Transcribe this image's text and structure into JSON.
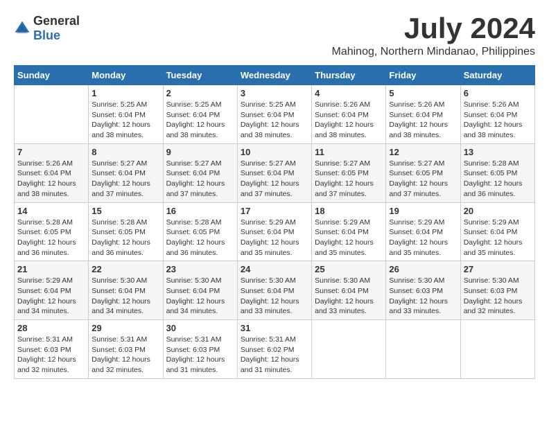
{
  "header": {
    "logo_general": "General",
    "logo_blue": "Blue",
    "month_title": "July 2024",
    "location": "Mahinog, Northern Mindanao, Philippines"
  },
  "calendar": {
    "days_of_week": [
      "Sunday",
      "Monday",
      "Tuesday",
      "Wednesday",
      "Thursday",
      "Friday",
      "Saturday"
    ],
    "weeks": [
      [
        {
          "day": "",
          "info": ""
        },
        {
          "day": "1",
          "info": "Sunrise: 5:25 AM\nSunset: 6:04 PM\nDaylight: 12 hours\nand 38 minutes."
        },
        {
          "day": "2",
          "info": "Sunrise: 5:25 AM\nSunset: 6:04 PM\nDaylight: 12 hours\nand 38 minutes."
        },
        {
          "day": "3",
          "info": "Sunrise: 5:25 AM\nSunset: 6:04 PM\nDaylight: 12 hours\nand 38 minutes."
        },
        {
          "day": "4",
          "info": "Sunrise: 5:26 AM\nSunset: 6:04 PM\nDaylight: 12 hours\nand 38 minutes."
        },
        {
          "day": "5",
          "info": "Sunrise: 5:26 AM\nSunset: 6:04 PM\nDaylight: 12 hours\nand 38 minutes."
        },
        {
          "day": "6",
          "info": "Sunrise: 5:26 AM\nSunset: 6:04 PM\nDaylight: 12 hours\nand 38 minutes."
        }
      ],
      [
        {
          "day": "7",
          "info": "Sunrise: 5:26 AM\nSunset: 6:04 PM\nDaylight: 12 hours\nand 38 minutes."
        },
        {
          "day": "8",
          "info": "Sunrise: 5:27 AM\nSunset: 6:04 PM\nDaylight: 12 hours\nand 37 minutes."
        },
        {
          "day": "9",
          "info": "Sunrise: 5:27 AM\nSunset: 6:04 PM\nDaylight: 12 hours\nand 37 minutes."
        },
        {
          "day": "10",
          "info": "Sunrise: 5:27 AM\nSunset: 6:04 PM\nDaylight: 12 hours\nand 37 minutes."
        },
        {
          "day": "11",
          "info": "Sunrise: 5:27 AM\nSunset: 6:05 PM\nDaylight: 12 hours\nand 37 minutes."
        },
        {
          "day": "12",
          "info": "Sunrise: 5:27 AM\nSunset: 6:05 PM\nDaylight: 12 hours\nand 37 minutes."
        },
        {
          "day": "13",
          "info": "Sunrise: 5:28 AM\nSunset: 6:05 PM\nDaylight: 12 hours\nand 36 minutes."
        }
      ],
      [
        {
          "day": "14",
          "info": "Sunrise: 5:28 AM\nSunset: 6:05 PM\nDaylight: 12 hours\nand 36 minutes."
        },
        {
          "day": "15",
          "info": "Sunrise: 5:28 AM\nSunset: 6:05 PM\nDaylight: 12 hours\nand 36 minutes."
        },
        {
          "day": "16",
          "info": "Sunrise: 5:28 AM\nSunset: 6:05 PM\nDaylight: 12 hours\nand 36 minutes."
        },
        {
          "day": "17",
          "info": "Sunrise: 5:29 AM\nSunset: 6:04 PM\nDaylight: 12 hours\nand 35 minutes."
        },
        {
          "day": "18",
          "info": "Sunrise: 5:29 AM\nSunset: 6:04 PM\nDaylight: 12 hours\nand 35 minutes."
        },
        {
          "day": "19",
          "info": "Sunrise: 5:29 AM\nSunset: 6:04 PM\nDaylight: 12 hours\nand 35 minutes."
        },
        {
          "day": "20",
          "info": "Sunrise: 5:29 AM\nSunset: 6:04 PM\nDaylight: 12 hours\nand 35 minutes."
        }
      ],
      [
        {
          "day": "21",
          "info": "Sunrise: 5:29 AM\nSunset: 6:04 PM\nDaylight: 12 hours\nand 34 minutes."
        },
        {
          "day": "22",
          "info": "Sunrise: 5:30 AM\nSunset: 6:04 PM\nDaylight: 12 hours\nand 34 minutes."
        },
        {
          "day": "23",
          "info": "Sunrise: 5:30 AM\nSunset: 6:04 PM\nDaylight: 12 hours\nand 34 minutes."
        },
        {
          "day": "24",
          "info": "Sunrise: 5:30 AM\nSunset: 6:04 PM\nDaylight: 12 hours\nand 33 minutes."
        },
        {
          "day": "25",
          "info": "Sunrise: 5:30 AM\nSunset: 6:04 PM\nDaylight: 12 hours\nand 33 minutes."
        },
        {
          "day": "26",
          "info": "Sunrise: 5:30 AM\nSunset: 6:03 PM\nDaylight: 12 hours\nand 33 minutes."
        },
        {
          "day": "27",
          "info": "Sunrise: 5:30 AM\nSunset: 6:03 PM\nDaylight: 12 hours\nand 32 minutes."
        }
      ],
      [
        {
          "day": "28",
          "info": "Sunrise: 5:31 AM\nSunset: 6:03 PM\nDaylight: 12 hours\nand 32 minutes."
        },
        {
          "day": "29",
          "info": "Sunrise: 5:31 AM\nSunset: 6:03 PM\nDaylight: 12 hours\nand 32 minutes."
        },
        {
          "day": "30",
          "info": "Sunrise: 5:31 AM\nSunset: 6:03 PM\nDaylight: 12 hours\nand 31 minutes."
        },
        {
          "day": "31",
          "info": "Sunrise: 5:31 AM\nSunset: 6:02 PM\nDaylight: 12 hours\nand 31 minutes."
        },
        {
          "day": "",
          "info": ""
        },
        {
          "day": "",
          "info": ""
        },
        {
          "day": "",
          "info": ""
        }
      ]
    ]
  }
}
